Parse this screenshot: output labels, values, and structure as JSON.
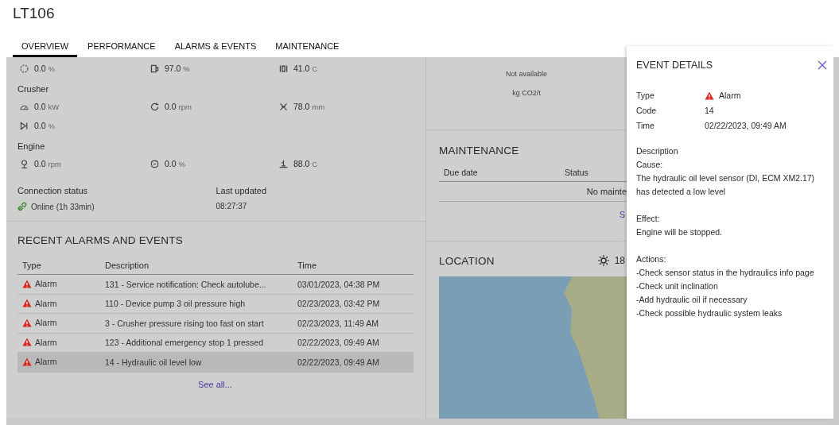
{
  "title": "LT106",
  "tabs": [
    {
      "label": "OVERVIEW",
      "selected": true
    },
    {
      "label": "PERFORMANCE",
      "selected": false
    },
    {
      "label": "ALARMS & EVENTS",
      "selected": false
    },
    {
      "label": "MAINTENANCE",
      "selected": false
    }
  ],
  "metrics": [
    {
      "kind": "values",
      "items": [
        {
          "value": "0.0",
          "unit": "%"
        },
        {
          "value": "97.0",
          "unit": "%"
        },
        {
          "value": "41.0",
          "unit": "C"
        }
      ]
    },
    {
      "kind": "heading",
      "text": "Crusher"
    },
    {
      "kind": "values",
      "items": [
        {
          "value": "0.0",
          "unit": "kW"
        },
        {
          "value": "0.0",
          "unit": "rpm"
        },
        {
          "value": "78.0",
          "unit": "mm"
        }
      ]
    },
    {
      "kind": "values",
      "items": [
        {
          "value": "0.0",
          "unit": "%"
        }
      ]
    },
    {
      "kind": "heading",
      "text": "Engine"
    },
    {
      "kind": "values",
      "items": [
        {
          "value": "0.0",
          "unit": "rpm"
        },
        {
          "value": "0.0",
          "unit": "%"
        },
        {
          "value": "88.0",
          "unit": "C"
        }
      ]
    }
  ],
  "connection": {
    "label": "Connection status",
    "value": "Online (1h 33min)",
    "updated_label": "Last updated",
    "updated_value": "08:27:37"
  },
  "alarms": {
    "title": "RECENT ALARMS AND EVENTS",
    "columns": [
      "Type",
      "Description",
      "Time"
    ],
    "rows": [
      {
        "type": "Alarm",
        "description": "131 - Service notification: Check autolube...",
        "time": "03/01/2023, 04:38 PM",
        "selected": false
      },
      {
        "type": "Alarm",
        "description": "110 - Device pump 3 oil pressure high",
        "time": "02/23/2023, 03:42 PM",
        "selected": false
      },
      {
        "type": "Alarm",
        "description": "3 - Crusher pressure rising too fast on start",
        "time": "02/23/2023, 11:49 AM",
        "selected": false
      },
      {
        "type": "Alarm",
        "description": "123 - Additional emergency stop 1 pressed",
        "time": "02/22/2023, 09:49 AM",
        "selected": false
      },
      {
        "type": "Alarm",
        "description": "14 - Hydraulic oil level low",
        "time": "02/22/2023, 09:49 AM",
        "selected": true
      }
    ],
    "see_all": "See all..."
  },
  "emissions": {
    "value": "Not available",
    "unit": "kg CO2/t"
  },
  "maintenance": {
    "title": "MAINTENANCE",
    "columns": [
      "Due date",
      "Status"
    ],
    "empty": "No mainte",
    "see_all": "S"
  },
  "location": {
    "title": "LOCATION",
    "weather": "18"
  },
  "event_details": {
    "title": "EVENT DETAILS",
    "fields": [
      {
        "label": "Type",
        "value": "Alarm",
        "kind": "alarm"
      },
      {
        "label": "Code",
        "value": "14",
        "kind": "text"
      },
      {
        "label": "Time",
        "value": "02/22/2023, 09:49 AM",
        "kind": "text"
      }
    ],
    "description_label": "Description",
    "lines": [
      {
        "text": "Cause:",
        "kind": "line"
      },
      {
        "text": "The hydraulic oil level sensor (DI, ECM XM2.17) has detected a low level",
        "kind": "line"
      },
      {
        "kind": "gap"
      },
      {
        "text": "Effect:",
        "kind": "line"
      },
      {
        "text": "Engine will be stopped.",
        "kind": "line"
      },
      {
        "kind": "gap"
      },
      {
        "text": "Actions:",
        "kind": "line"
      },
      {
        "text": "-Check sensor status in the hydraulics info page",
        "kind": "line"
      },
      {
        "text": "-Check unit inclination",
        "kind": "line"
      },
      {
        "text": "-Add hydraulic oil if necessary",
        "kind": "line"
      },
      {
        "text": "-Check possible hydraulic system leaks",
        "kind": "line"
      }
    ]
  }
}
